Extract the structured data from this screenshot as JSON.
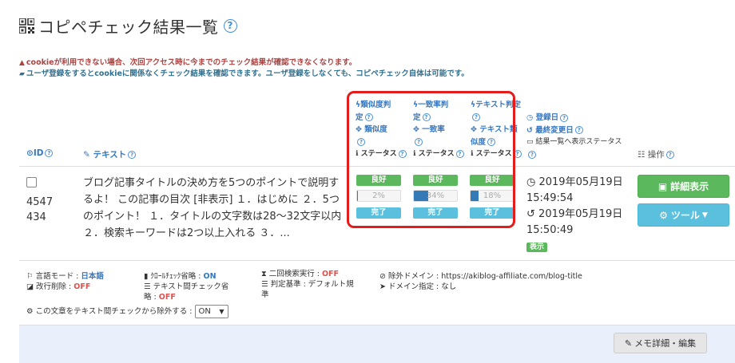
{
  "header": {
    "title": "コピペチェック結果一覧",
    "help": "?"
  },
  "notices": {
    "cookie_warning": "cookieが利用できない場合、次回アクセス時に今までのチェック結果が確認できなくなります。",
    "user_info": "ユーザ登録をするとcookieに関係なくチェック結果を確認できます。ユーザ登録をしなくても、コピペチェック自体は可能です。"
  },
  "table_header": {
    "id": "ID",
    "text": "テキスト",
    "similarity": {
      "l1": "類似度判",
      "l2": "定",
      "l3": "類似度",
      "status": "ステータス"
    },
    "match": {
      "l1": "一致率判",
      "l2": "定",
      "l3": "一致率",
      "status": "ステータス"
    },
    "textcheck": {
      "l1": "テキスト判定",
      "l3a": "テキスト類",
      "l3b": "似度",
      "status": "ステータス"
    },
    "dates": {
      "registered": "登録日",
      "modified": "最終変更日",
      "list_status": "結果一覧へ表示ステータス"
    },
    "ops": "操作"
  },
  "row": {
    "id": "4547434",
    "text": "ブログ記事タイトルの決め方を5つのポイントで説明するよ！ この記事の目次 [非表示] １．はじめに ２．5つのポイント！ １．タイトルの文字数は28〜32文字以内 ２．検索キーワードは2つ以上入れる ３．...",
    "similarity": {
      "judge": "良好",
      "value": "2%",
      "status": "完了"
    },
    "match": {
      "judge": "良好",
      "value": "34%",
      "status": "完了"
    },
    "textcheck": {
      "judge": "良好",
      "value": "18%",
      "status": "完了"
    },
    "registered": "2019年05月19日 15:49:54",
    "registered_date": "2019年05月19日",
    "registered_time": "15:49:54",
    "modified_date": "2019年05月19日",
    "modified_time": "15:50:49",
    "display_badge": "表示",
    "detail_button": "詳細表示",
    "tool_button": "ツール"
  },
  "progress": {
    "similarity": 0.02,
    "match": 0.34,
    "textcheck": 0.18
  },
  "settings": {
    "lang_label": "言語モード : ",
    "lang_value": "日本語",
    "newline_label": "改行削除 : ",
    "newline_value": "OFF",
    "crawl_label": "ｸﾛｰﾙﾁｪｯｸ省略 : ",
    "crawl_value": "ON",
    "intertext_label1": "テキスト間チェック省",
    "intertext_label2": "略 : ",
    "intertext_value": "OFF",
    "second_label": "二回検索実行 : ",
    "second_value": "OFF",
    "criteria_label1": "判定基準 : デフォルト規",
    "criteria_label2": "準",
    "exclude_domain": "除外ドメイン : https://akiblog-affiliate.com/blog-title",
    "domain_spec": "ドメイン指定 : なし",
    "exclude_question": "この文章をテキスト間チェックから除外する : ",
    "exclude_select": "ON"
  },
  "memo_button": "メモ詳細・編集",
  "colors": {
    "good": "#5cb85c",
    "done": "#5bc0de",
    "link": "#3577c1",
    "highlight": "#e41c1c"
  }
}
